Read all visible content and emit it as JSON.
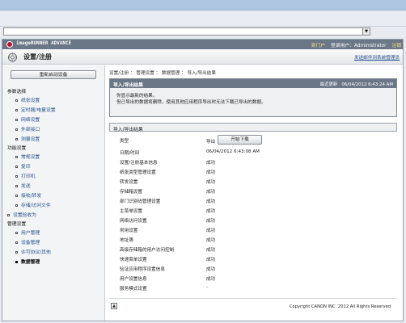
{
  "browser": {
    "address_value": "",
    "dropdown_icon": "chevron-down-icon"
  },
  "header": {
    "product": "imageRUNNER ADVANCE",
    "portal": "到门户",
    "login_user": "登录用户：Administrator",
    "logout": "注销"
  },
  "titlebar": {
    "title": "设置/注册",
    "mail_link": "发送邮件到系统管理员"
  },
  "sidebar": {
    "start_button": "重新启动设备",
    "sections": [
      {
        "label": "参数选择",
        "items": [
          "纸张设置",
          "定时器/电量设置",
          "网络设置",
          "外部接口",
          "测量设置"
        ]
      },
      {
        "label": "功能设置",
        "items": [
          "常规设置",
          "复印",
          "打印机",
          "发送",
          "接收/转发",
          "存储/访问文件"
        ]
      },
      {
        "label": "设置验收为",
        "items": []
      },
      {
        "label": "管理设置",
        "items": [
          "用户管理",
          "设备管理",
          "许可协议/其他",
          "数据管理"
        ]
      }
    ],
    "selected_item": "数据管理"
  },
  "breadcrumb": "设置/注册 ： 管理设置 ： 数据管理 ： 导入/导出结果",
  "result_box": {
    "title": "导入/导出结果",
    "update_label": "最近更新",
    "update_time": "06/04/2012 6:43:24 AM",
    "messages": [
      "你显示最新的结果。",
      "但已导出的数据将删除，使用其他应用程序导出时无法下载已导出的数据。"
    ]
  },
  "panel": {
    "title": "导入/导出结果",
    "type_label": "类型",
    "type_value": "导出",
    "start_button": "开始下载",
    "datetime_label": "日期/时间",
    "datetime_value": "06/04/2012 6:43:08 AM",
    "rows": [
      {
        "label": "设置/注册基本信息",
        "value": "成功"
      },
      {
        "label": "纸张类型管理设置",
        "value": "成功"
      },
      {
        "label": "转发设置",
        "value": "成功"
      },
      {
        "label": "存储箱设置",
        "value": "成功"
      },
      {
        "label": "部门识别码管理设置",
        "value": "成功"
      },
      {
        "label": "主菜单设置",
        "value": "成功"
      },
      {
        "label": "网络访问设置",
        "value": "成功"
      },
      {
        "label": "常用设置",
        "value": "成功"
      },
      {
        "label": "地址簿",
        "value": "成功"
      },
      {
        "label": "高级存储箱的用户访问控制",
        "value": "成功"
      },
      {
        "label": "快速菜单设置",
        "value": "成功"
      },
      {
        "label": "验证应用程序设置信息",
        "value": "成功"
      },
      {
        "label": "用户设置信息",
        "value": "成功"
      },
      {
        "label": "服务模式设置",
        "value": "-"
      }
    ]
  },
  "footer": {
    "top_icon": "page-top-icon",
    "copyright": "Copyright CANON INC. 2012 All Rights Reserved"
  }
}
